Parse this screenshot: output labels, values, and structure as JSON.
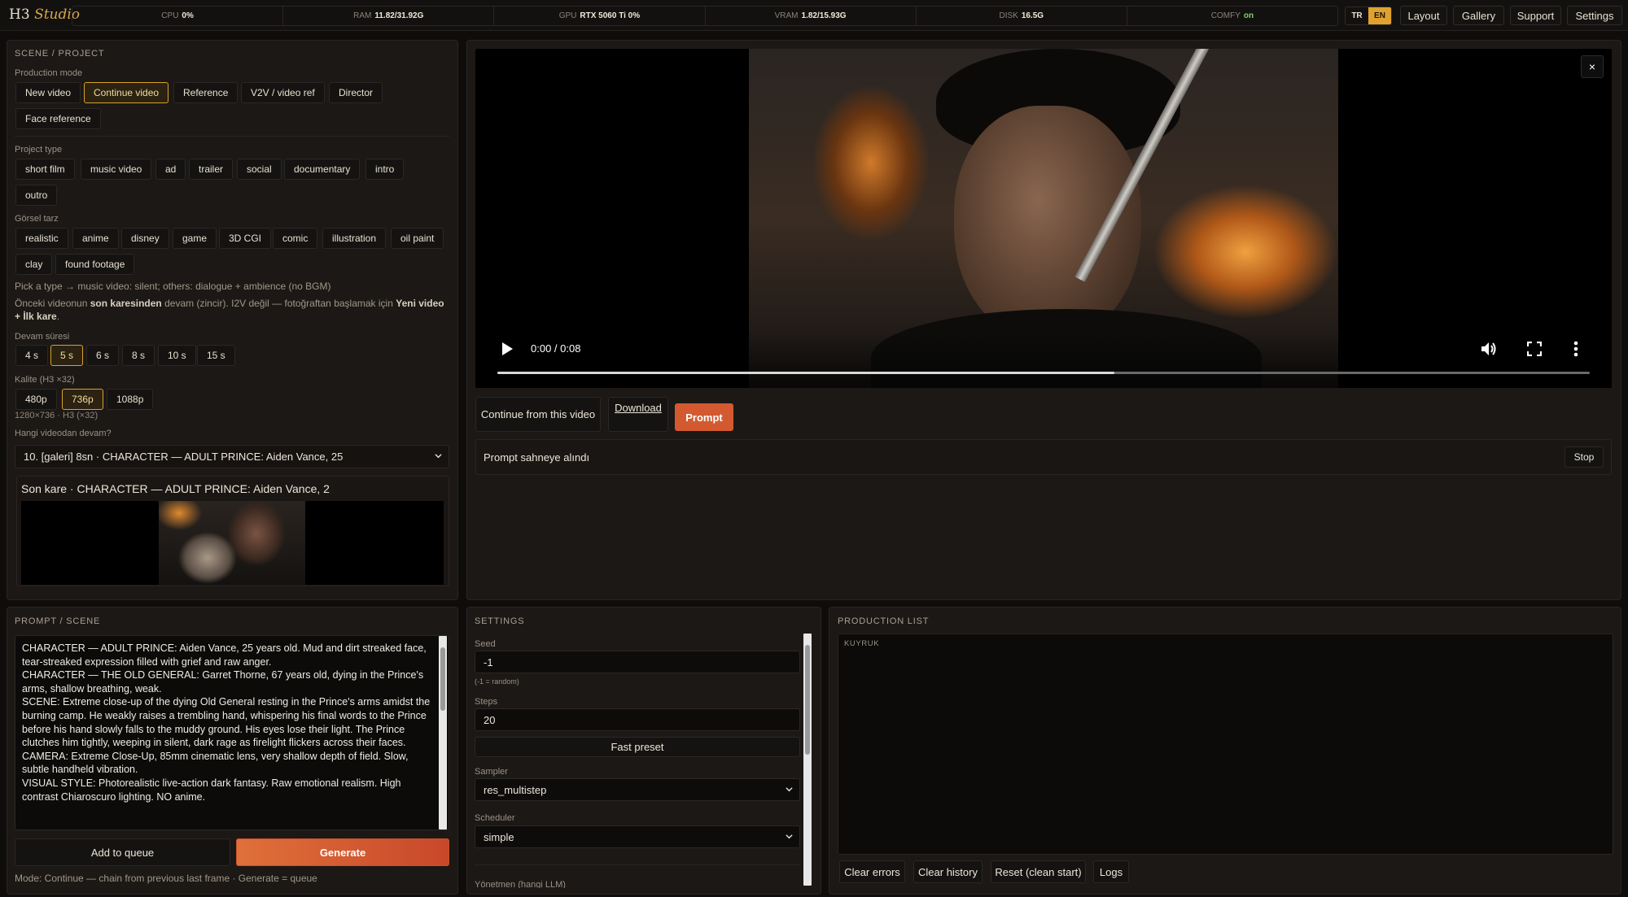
{
  "app": {
    "brand_main": "H3",
    "brand_italic": "Studio"
  },
  "stats": [
    {
      "key": "CPU",
      "value": "0%"
    },
    {
      "key": "RAM",
      "value": "11.82/31.92G"
    },
    {
      "key": "GPU",
      "value": "RTX 5060 Ti 0%"
    },
    {
      "key": "VRAM",
      "value": "1.82/15.93G"
    },
    {
      "key": "DISK",
      "value": "16.5G"
    },
    {
      "key": "COMFY",
      "value": "on"
    }
  ],
  "lang": {
    "tr": "TR",
    "en": "EN",
    "active": "EN"
  },
  "nav": {
    "layout": "Layout",
    "gallery": "Gallery",
    "support": "Support",
    "settings": "Settings"
  },
  "scene": {
    "title": "SCENE / PROJECT",
    "mode_label": "Production mode",
    "modes": [
      "New video",
      "Continue video",
      "Reference",
      "V2V / video ref",
      "Director",
      "Face reference"
    ],
    "mode_selected": "Continue video",
    "type_label": "Project type",
    "types": [
      "short film",
      "music video",
      "ad",
      "trailer",
      "social",
      "documentary",
      "intro",
      "outro"
    ],
    "style_label": "Görsel tarz",
    "styles": [
      "realistic",
      "anime",
      "disney",
      "game",
      "3D CGI",
      "comic",
      "illustration",
      "oil paint",
      "clay",
      "found footage"
    ],
    "note1": "Pick a type → music video: silent; others: dialogue + ambience (no BGM)",
    "note2_a": "Önceki videonun ",
    "note2_b": "son karesinden",
    "note2_c": " devam (zincir). I2V değil — fotoğraftan başlamak için ",
    "note2_d": "Yeni video",
    "note2_e": "+ İlk kare",
    "note2_f": ".",
    "duration_label": "Devam süresi",
    "durations": [
      "4 s",
      "5 s",
      "6 s",
      "8 s",
      "10 s",
      "15 s"
    ],
    "duration_selected": "5 s",
    "quality_label": "Kalite (H3 ×32)",
    "qualities": [
      "480p",
      "736p",
      "1088p"
    ],
    "quality_selected": "736p",
    "resolution_note": "1280×736 · H3 (×32)",
    "source_label": "Hangi videodan devam?",
    "source_value": "10. [galeri] 8sn · CHARACTER — ADULT PRINCE: Aiden Vance, 25",
    "last_frame_title": "Son kare · CHARACTER — ADULT PRINCE: Aiden Vance, 2"
  },
  "player": {
    "close": "×",
    "time": "0:00 / 0:08",
    "progress": 0.565,
    "continue_btn": "Continue from this video",
    "download_btn": "Download",
    "prompt_btn": "Prompt",
    "status": "Prompt sahneye alındı",
    "stop_btn": "Stop"
  },
  "prompt": {
    "title": "PROMPT / SCENE",
    "text": "CHARACTER — ADULT PRINCE: Aiden Vance, 25 years old. Mud and dirt streaked face, tear-streaked expression filled with grief and raw anger.\nCHARACTER — THE OLD GENERAL: Garret Thorne, 67 years old, dying in the Prince's arms, shallow breathing, weak.\nSCENE: Extreme close-up of the dying Old General resting in the Prince's arms amidst the burning camp. He weakly raises a trembling hand, whispering his final words to the Prince before his hand slowly falls to the muddy ground. His eyes lose their light. The Prince clutches him tightly, weeping in silent, dark rage as firelight flickers across their faces.\nCAMERA: Extreme Close-Up, 85mm cinematic lens, very shallow depth of field. Slow, subtle handheld vibration.\nVISUAL STYLE: Photorealistic live-action dark fantasy. Raw emotional realism. High contrast Chiaroscuro lighting. NO anime.",
    "add_queue": "Add to queue",
    "generate": "Generate",
    "mode_note": "Mode: Continue — chain from previous last frame · Generate = queue"
  },
  "settings": {
    "title": "SETTINGS",
    "seed_label": "Seed",
    "seed_value": "-1",
    "seed_note": "(-1 = random)",
    "steps_label": "Steps",
    "steps_value": "20",
    "fast_preset": "Fast preset",
    "sampler_label": "Sampler",
    "sampler_value": "res_multistep",
    "scheduler_label": "Scheduler",
    "scheduler_value": "simple",
    "director_label": "Yönetmen (hangi LLM)"
  },
  "production": {
    "title": "PRODUCTION LIST",
    "queue_label": "KUYRUK",
    "clear_errors": "Clear errors",
    "clear_history": "Clear history",
    "reset": "Reset (clean start)",
    "logs": "Logs"
  },
  "colors": {
    "accent": "#e0a12f",
    "orange": "#d35a30",
    "bg": "#0f0d0b",
    "panel": "#1c1815"
  }
}
